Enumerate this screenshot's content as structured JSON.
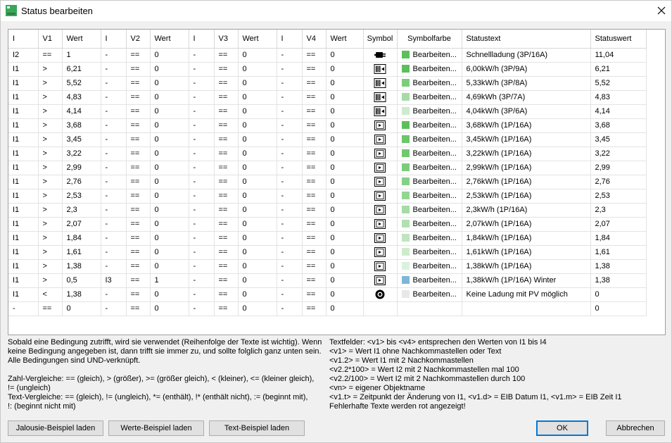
{
  "window": {
    "title": "Status bearbeiten"
  },
  "table": {
    "headers": [
      "I",
      "V1",
      "Wert",
      "I",
      "V2",
      "Wert",
      "I",
      "V3",
      "Wert",
      "I",
      "V4",
      "Wert",
      "Symbol",
      "Symbolfarbe",
      "Statustext",
      "Statuswert"
    ],
    "rows": [
      {
        "c": [
          "I2",
          "==",
          "1",
          "-",
          "==",
          "0",
          "-",
          "==",
          "0",
          "-",
          "==",
          "0"
        ],
        "symbol": "plug-icon",
        "color": "#5cbf5c",
        "farbe": "Bearbeiten...",
        "text": "Schnellladung (3P/16A)",
        "wert": "11,04"
      },
      {
        "c": [
          "I1",
          ">",
          "6,21",
          "-",
          "==",
          "0",
          "-",
          "==",
          "0",
          "-",
          "==",
          "0"
        ],
        "symbol": "charger-3p-icon",
        "color": "#5cbf5c",
        "farbe": "Bearbeiten...",
        "text": "6,00kW/h (3P/9A)",
        "wert": "6,21"
      },
      {
        "c": [
          "I1",
          ">",
          "5,52",
          "-",
          "==",
          "0",
          "-",
          "==",
          "0",
          "-",
          "==",
          "0"
        ],
        "symbol": "charger-3p-icon",
        "color": "#7dcc7d",
        "farbe": "Bearbeiten...",
        "text": "5,33kW/h (3P/8A)",
        "wert": "5,52"
      },
      {
        "c": [
          "I1",
          ">",
          "4,83",
          "-",
          "==",
          "0",
          "-",
          "==",
          "0",
          "-",
          "==",
          "0"
        ],
        "symbol": "charger-3p-icon",
        "color": "#a6dba6",
        "farbe": "Bearbeiten...",
        "text": "4,69kWh (3P/7A)",
        "wert": "4,83"
      },
      {
        "c": [
          "I1",
          ">",
          "4,14",
          "-",
          "==",
          "0",
          "-",
          "==",
          "0",
          "-",
          "==",
          "0"
        ],
        "symbol": "charger-3p-icon",
        "color": "#cdebcd",
        "farbe": "Bearbeiten...",
        "text": "4,04kW/h (3P/6A)",
        "wert": "4,14"
      },
      {
        "c": [
          "I1",
          ">",
          "3,68",
          "-",
          "==",
          "0",
          "-",
          "==",
          "0",
          "-",
          "==",
          "0"
        ],
        "symbol": "charger-1p-icon",
        "color": "#5cbf5c",
        "farbe": "Bearbeiten...",
        "text": "3,68kW/h (1P/16A)",
        "wert": "3,68"
      },
      {
        "c": [
          "I1",
          ">",
          "3,45",
          "-",
          "==",
          "0",
          "-",
          "==",
          "0",
          "-",
          "==",
          "0"
        ],
        "symbol": "charger-1p-icon",
        "color": "#6cc66c",
        "farbe": "Bearbeiten...",
        "text": "3,45kW/h (1P/16A)",
        "wert": "3,45"
      },
      {
        "c": [
          "I1",
          ">",
          "3,22",
          "-",
          "==",
          "0",
          "-",
          "==",
          "0",
          "-",
          "==",
          "0"
        ],
        "symbol": "charger-1p-icon",
        "color": "#72c872",
        "farbe": "Bearbeiten...",
        "text": "3,22kW/h (1P/16A)",
        "wert": "3,22"
      },
      {
        "c": [
          "I1",
          ">",
          "2,99",
          "-",
          "==",
          "0",
          "-",
          "==",
          "0",
          "-",
          "==",
          "0"
        ],
        "symbol": "charger-1p-icon",
        "color": "#7dcc7d",
        "farbe": "Bearbeiten...",
        "text": "2,99kW/h (1P/16A)",
        "wert": "2,99"
      },
      {
        "c": [
          "I1",
          ">",
          "2,76",
          "-",
          "==",
          "0",
          "-",
          "==",
          "0",
          "-",
          "==",
          "0"
        ],
        "symbol": "charger-1p-icon",
        "color": "#88d088",
        "farbe": "Bearbeiten...",
        "text": "2,76kW/h (1P/16A)",
        "wert": "2,76"
      },
      {
        "c": [
          "I1",
          ">",
          "2,53",
          "-",
          "==",
          "0",
          "-",
          "==",
          "0",
          "-",
          "==",
          "0"
        ],
        "symbol": "charger-1p-icon",
        "color": "#94d594",
        "farbe": "Bearbeiten...",
        "text": "2,53kW/h (1P/16A)",
        "wert": "2,53"
      },
      {
        "c": [
          "I1",
          ">",
          "2,3",
          "-",
          "==",
          "0",
          "-",
          "==",
          "0",
          "-",
          "==",
          "0"
        ],
        "symbol": "charger-1p-icon",
        "color": "#a6dba6",
        "farbe": "Bearbeiten...",
        "text": "2,3kW/h (1P/16A)",
        "wert": "2,3"
      },
      {
        "c": [
          "I1",
          ">",
          "2,07",
          "-",
          "==",
          "0",
          "-",
          "==",
          "0",
          "-",
          "==",
          "0"
        ],
        "symbol": "charger-1p-icon",
        "color": "#b2e0b2",
        "farbe": "Bearbeiten...",
        "text": "2,07kW/h (1P/16A)",
        "wert": "2,07"
      },
      {
        "c": [
          "I1",
          ">",
          "1,84",
          "-",
          "==",
          "0",
          "-",
          "==",
          "0",
          "-",
          "==",
          "0"
        ],
        "symbol": "charger-1p-icon",
        "color": "#bee5be",
        "farbe": "Bearbeiten...",
        "text": "1,84kW/h (1P/16A)",
        "wert": "1,84"
      },
      {
        "c": [
          "I1",
          ">",
          "1,61",
          "-",
          "==",
          "0",
          "-",
          "==",
          "0",
          "-",
          "==",
          "0"
        ],
        "symbol": "charger-1p-icon",
        "color": "#cdebcd",
        "farbe": "Bearbeiten...",
        "text": "1,61kW/h (1P/16A)",
        "wert": "1,61"
      },
      {
        "c": [
          "I1",
          ">",
          "1,38",
          "-",
          "==",
          "0",
          "-",
          "==",
          "0",
          "-",
          "==",
          "0"
        ],
        "symbol": "charger-1p-icon",
        "color": "#dcf1dc",
        "farbe": "Bearbeiten...",
        "text": "1,38kW/h (1P/16A)",
        "wert": "1,38"
      },
      {
        "c": [
          "I1",
          ">",
          "0,5",
          "I3",
          "==",
          "1",
          "-",
          "==",
          "0",
          "-",
          "==",
          "0"
        ],
        "symbol": "charger-1p-icon",
        "color": "#7fb6d6",
        "farbe": "Bearbeiten...",
        "text": "1,38kW/h (1P/16A) Winter",
        "wert": "1,38"
      },
      {
        "c": [
          "I1",
          "<",
          "1,38",
          "-",
          "==",
          "0",
          "-",
          "==",
          "0",
          "-",
          "==",
          "0"
        ],
        "symbol": "sun-off-icon",
        "color": "#e8e8e8",
        "farbe": "Bearbeiten...",
        "text": "Keine Ladung mit PV möglich",
        "wert": "0"
      },
      {
        "c": [
          "-",
          "==",
          "0",
          "-",
          "==",
          "0",
          "-",
          "==",
          "0",
          "-",
          "==",
          "0"
        ],
        "symbol": "",
        "color": "",
        "farbe": "",
        "text": "",
        "wert": "0"
      }
    ]
  },
  "help_left": "Sobald eine Bedingung zutrifft, wird sie verwendet (Reihenfolge der Texte ist wichtig). Wenn\nkeine Bedingung angegeben ist, dann trifft sie immer zu, und sollte folglich ganz unten sein.\nAlle Bedingungen sind UND-verknüpft.\n\nZahl-Vergleiche: == (gleich), > (größer), >= (größer gleich), < (kleiner), <= (kleiner gleich),\n!= (ungleich)\nText-Vergleiche: == (gleich), != (ungleich), *= (enthält), !* (enthält nicht), := (beginnt mit),\n!: (beginnt nicht mit)",
  "help_right": "Textfelder: <v1> bis <v4> entsprechen den Werten von I1 bis I4\n<v1> = Wert I1 ohne Nachkommastellen oder Text\n<v1.2> = Wert I1 mit 2 Nachkommastellen\n<v2.2*100> = Wert I2 mit 2 Nachkommastellen mal 100\n<v2.2/100> = Wert I2 mit 2 Nachkommastellen durch 100\n<vn> = eigener Objektname\n<v1.t> = Zeitpunkt der Änderung von I1, <v1.d> = EIB Datum I1, <v1.m> = EIB Zeit I1\nFehlerhafte Texte werden rot angezeigt!",
  "buttons": {
    "jalousie": "Jalousie-Beispiel laden",
    "werte": "Werte-Beispiel laden",
    "text": "Text-Beispiel laden",
    "ok": "OK",
    "cancel": "Abbrechen"
  }
}
